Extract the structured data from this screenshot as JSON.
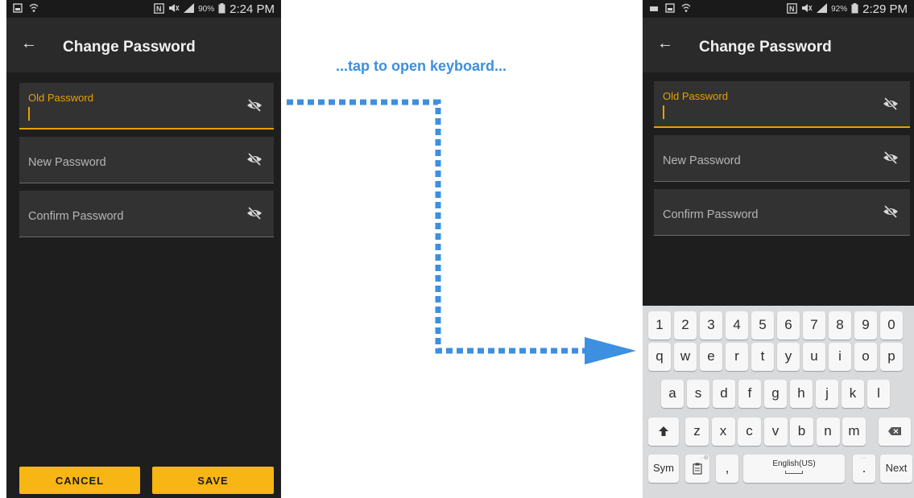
{
  "colors": {
    "accent": "#f8b614",
    "active_underline": "#e8a000",
    "callout": "#3d8fdf",
    "app_background": "#1e1e1e"
  },
  "annotation": {
    "callout_text": "...tap to open keyboard..."
  },
  "left_screen": {
    "status_bar": {
      "icons_left": [
        "gallery-icon",
        "wifi-icon"
      ],
      "icons_right": [
        "nfc-icon",
        "mute-icon",
        "signal-icon"
      ],
      "battery_percent": "90%",
      "time": "2:24 PM"
    },
    "app_bar": {
      "back_icon": "back-arrow-icon",
      "title": "Change Password"
    },
    "fields": [
      {
        "label": "Old Password",
        "active": true,
        "toggle_icon": "eye-off-icon"
      },
      {
        "label": "New Password",
        "active": false,
        "toggle_icon": "eye-off-icon"
      },
      {
        "label": "Confirm Password",
        "active": false,
        "toggle_icon": "eye-off-icon"
      }
    ],
    "buttons": {
      "cancel": "CANCEL",
      "save": "SAVE"
    }
  },
  "right_screen": {
    "status_bar": {
      "icons_left": [
        "message-icon",
        "gallery-icon",
        "wifi-icon"
      ],
      "icons_right": [
        "nfc-icon",
        "mute-icon",
        "signal-icon"
      ],
      "battery_percent": "92%",
      "time": "2:29 PM"
    },
    "app_bar": {
      "back_icon": "back-arrow-icon",
      "title": "Change Password"
    },
    "fields": [
      {
        "label": "Old Password",
        "active": true,
        "toggle_icon": "eye-off-icon"
      },
      {
        "label": "New Password",
        "active": false,
        "toggle_icon": "eye-off-icon"
      },
      {
        "label": "Confirm Password",
        "active": false,
        "toggle_icon": "eye-off-icon"
      }
    ],
    "keyboard": {
      "number_row": [
        "1",
        "2",
        "3",
        "4",
        "5",
        "6",
        "7",
        "8",
        "9",
        "0"
      ],
      "row1": [
        "q",
        "w",
        "e",
        "r",
        "t",
        "y",
        "u",
        "i",
        "o",
        "p"
      ],
      "row2": [
        "a",
        "s",
        "d",
        "f",
        "g",
        "h",
        "j",
        "k",
        "l"
      ],
      "row3": [
        "z",
        "x",
        "c",
        "v",
        "b",
        "n",
        "m"
      ],
      "shift_icon": "shift-icon",
      "backspace_icon": "backspace-icon",
      "sym_label": "Sym",
      "clipboard_icon": "clipboard-icon",
      "comma_label": ",",
      "space_label": "English(US)",
      "period_label": ".",
      "next_label": "Next"
    }
  }
}
